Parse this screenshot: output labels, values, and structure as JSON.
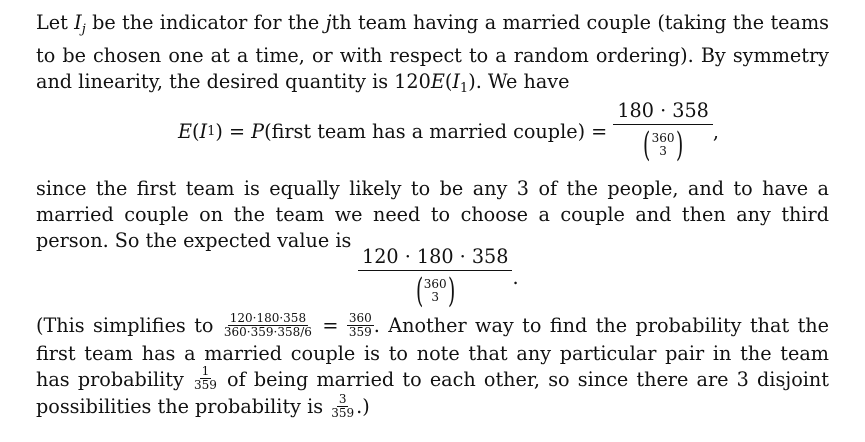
{
  "paragraph1": {
    "part_a": "Let ",
    "var_I": "I",
    "sub_j": "j",
    "part_b": " be the indicator for the ",
    "var_j": "j",
    "part_c": "th team having a married couple (taking the teams to be chosen one at a time, or with respect to a random ordering). By symmetry and linearity, the desired quantity is 120",
    "expr_E": "E",
    "expr_open": "(",
    "expr_I": "I",
    "expr_sub": "1",
    "expr_close": "). We have"
  },
  "equation1": {
    "lhs_E": "E",
    "lhs_open": "(",
    "lhs_I": "I",
    "lhs_sub": "1",
    "lhs_close": ")",
    "eq1": " = ",
    "P": "P",
    "prob_text": "(first team has a married couple)",
    "eq2": " = ",
    "numerator": "180 · 358",
    "binom_top": "360",
    "binom_bottom": "3",
    "paren_l": "(",
    "paren_r": ")",
    "trailing": ","
  },
  "paragraph2": {
    "text": "since the first team is equally likely to be any 3 of the people, and to have a married couple on the team we need to choose a couple and then any third person. So the expected value is"
  },
  "equation2": {
    "numerator": "120 · 180 · 358",
    "binom_top": "360",
    "binom_bottom": "3",
    "paren_l": "(",
    "paren_r": ")",
    "trailing": "."
  },
  "paragraph3": {
    "lead": "(This simplifies to ",
    "frac1_num": "120·180·358",
    "frac1_den": "360·359·358/6",
    "eq": " = ",
    "frac2_num": "360",
    "frac2_den": "359",
    "mid": ". Another way to find the probability that the first team has a married couple is to note that any particular pair in the team has probability ",
    "frac3_num": "1",
    "frac3_den": "359",
    "mid2": " of being married to each other, so since there are 3 disjoint possibilities the probability is ",
    "frac4_num": "3",
    "frac4_den": "359",
    "end": ".)"
  }
}
